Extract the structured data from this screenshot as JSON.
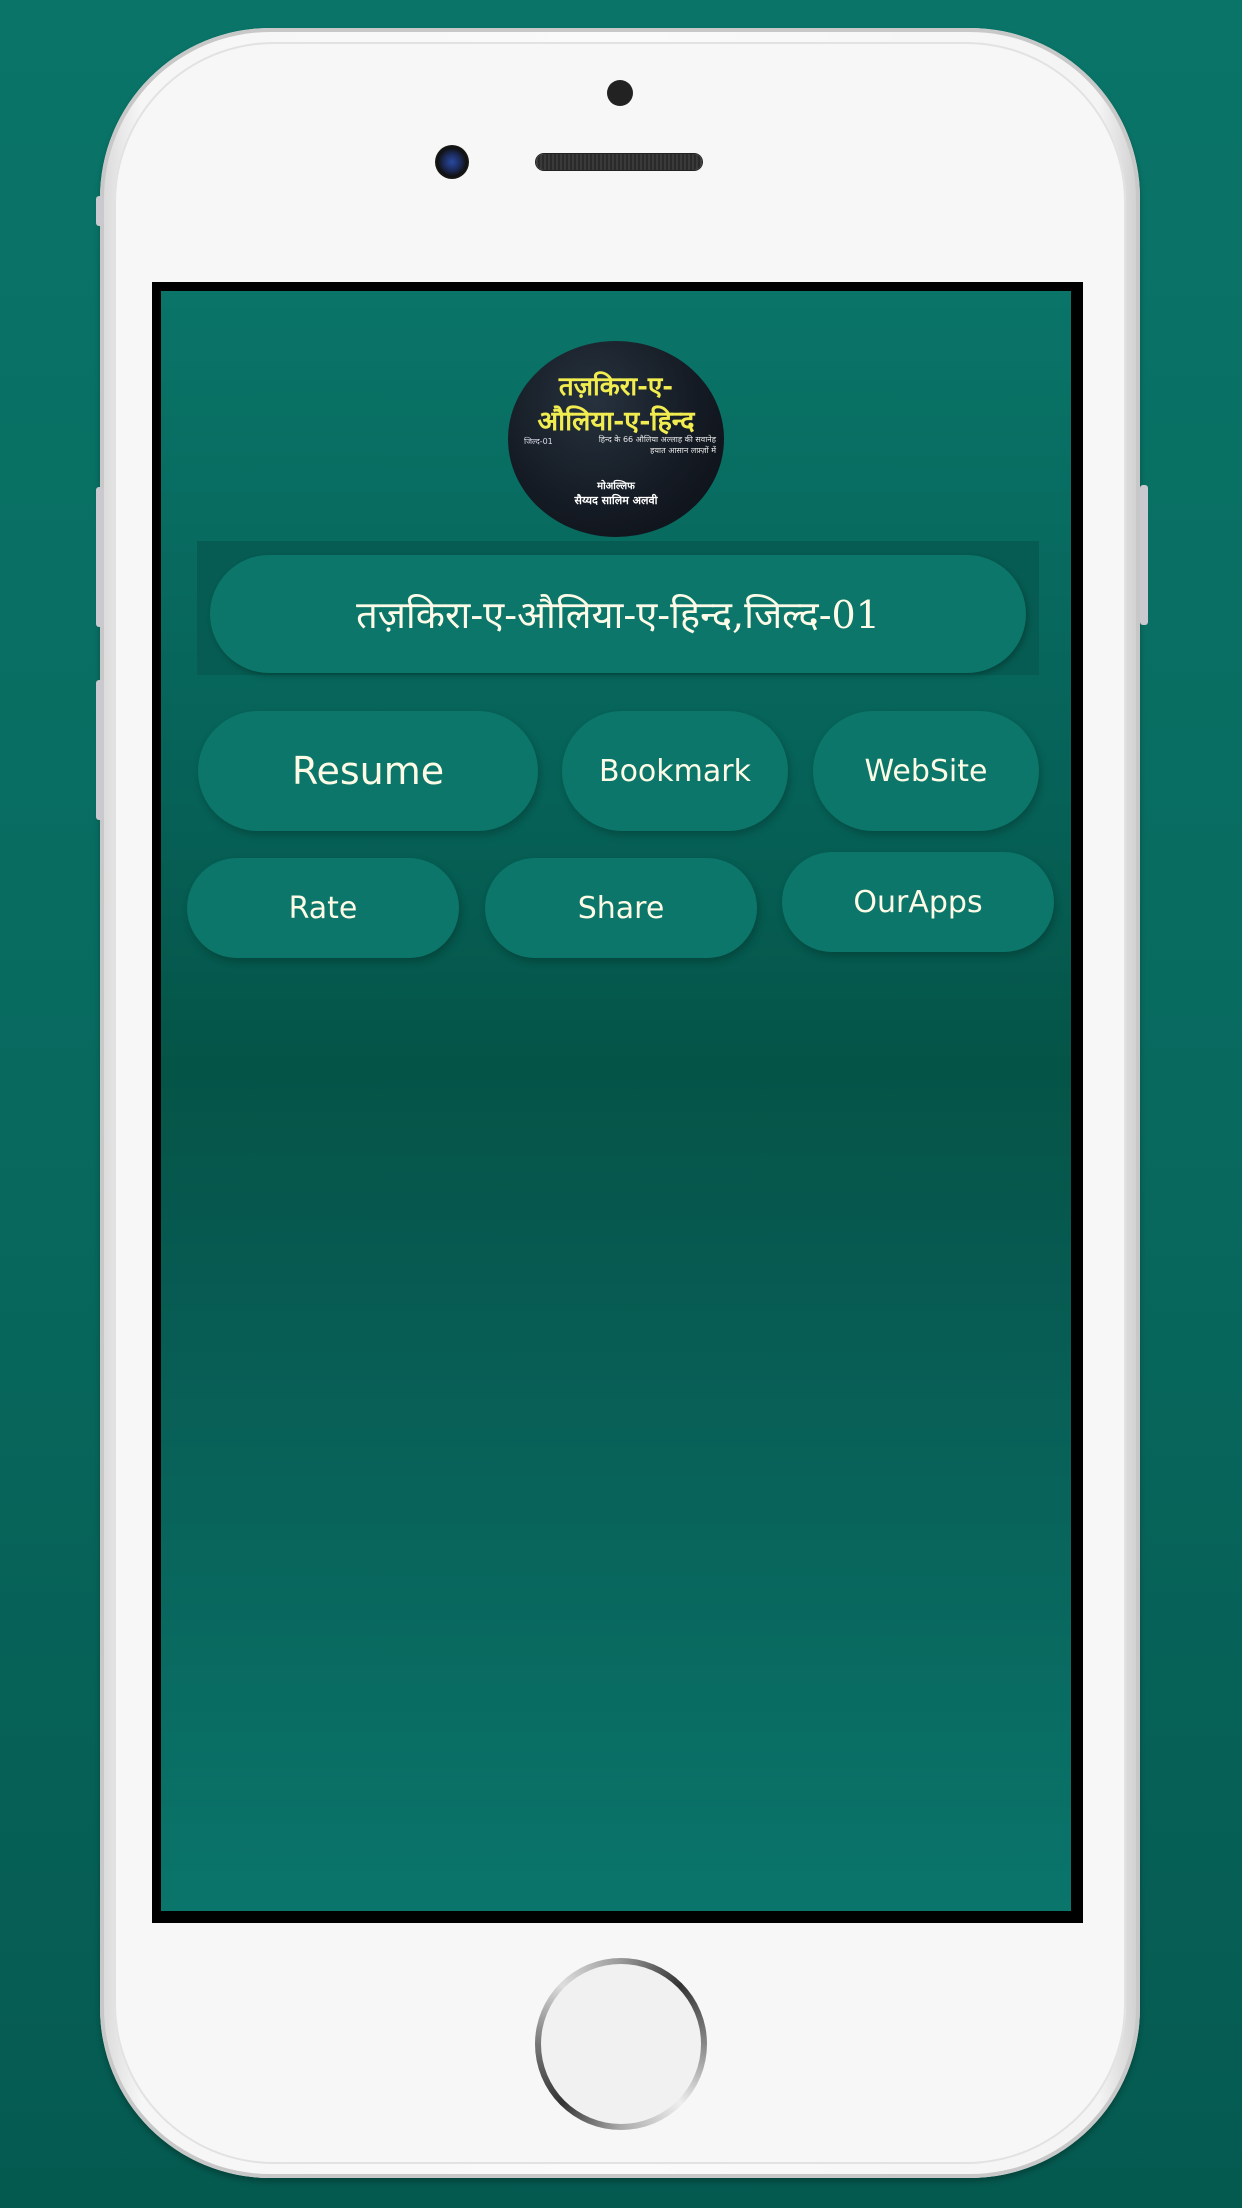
{
  "colors": {
    "background": "#087066",
    "app_background": "#066258",
    "button": "#0b7669",
    "button_text": "#fdfbe6",
    "cover_title": "#f1ec4f"
  },
  "cover": {
    "line1": "तज़किरा-ए-",
    "line2": "औलिया-ए-हिन्द",
    "volume": "जिल्द-01",
    "subtitle1": "हिन्द के 66 औलिया अल्लाह की सवानेह",
    "subtitle2": "हयात आसान लफ़्ज़ों में",
    "author_label": "मोअल्लिफ",
    "author_name": "सैय्यद सालिम अलवी"
  },
  "title": "तज़किरा-ए-औलिया-ए-हिन्द,जिल्द-01",
  "buttons": {
    "resume": "Resume",
    "bookmark": "Bookmark",
    "website": "WebSite",
    "rate": "Rate",
    "share": "Share",
    "ourapps": "OurApps"
  }
}
